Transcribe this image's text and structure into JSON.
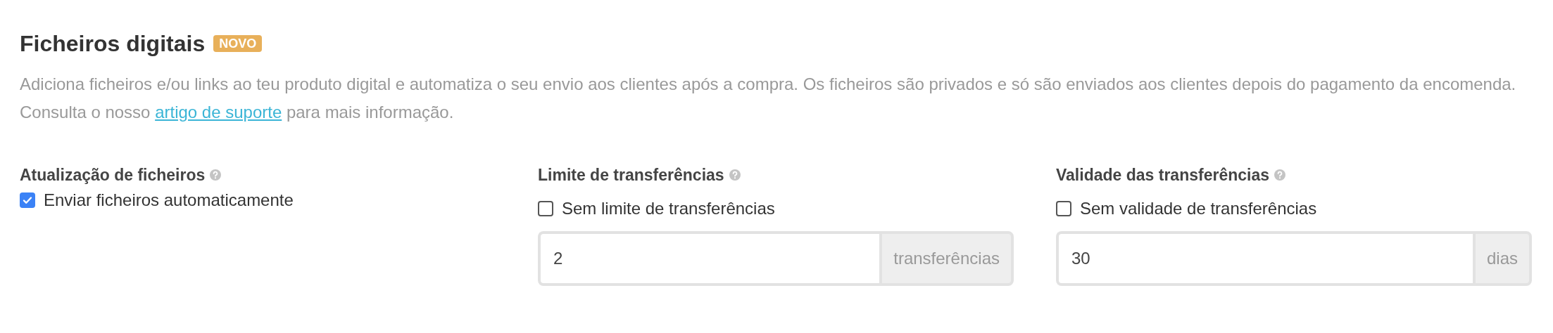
{
  "section": {
    "title": "Ficheiros digitais",
    "badge": "NOVO",
    "description_before": "Adiciona ficheiros e/ou links ao teu produto digital e automatiza o seu envio aos clientes após a compra. Os ficheiros são privados e só são enviados aos clientes depois do pagamento da encomenda. Consulta o nosso",
    "link": "artigo de suporte",
    "description_after": "para mais informação."
  },
  "settings": [
    {
      "label": "Atualização de ficheiros",
      "checkbox": {
        "label": "Enviar ficheiros automaticamente",
        "checked": true
      }
    },
    {
      "label": "Limite de transferências",
      "checkbox": {
        "label": "Sem limite de transferências",
        "checked": false
      },
      "input": {
        "value": "2",
        "suffix": "transferências"
      }
    },
    {
      "label": "Validade das transferências",
      "checkbox": {
        "label": "Sem validade de transferências",
        "checked": false
      },
      "input": {
        "value": "30",
        "suffix": "dias"
      }
    }
  ]
}
